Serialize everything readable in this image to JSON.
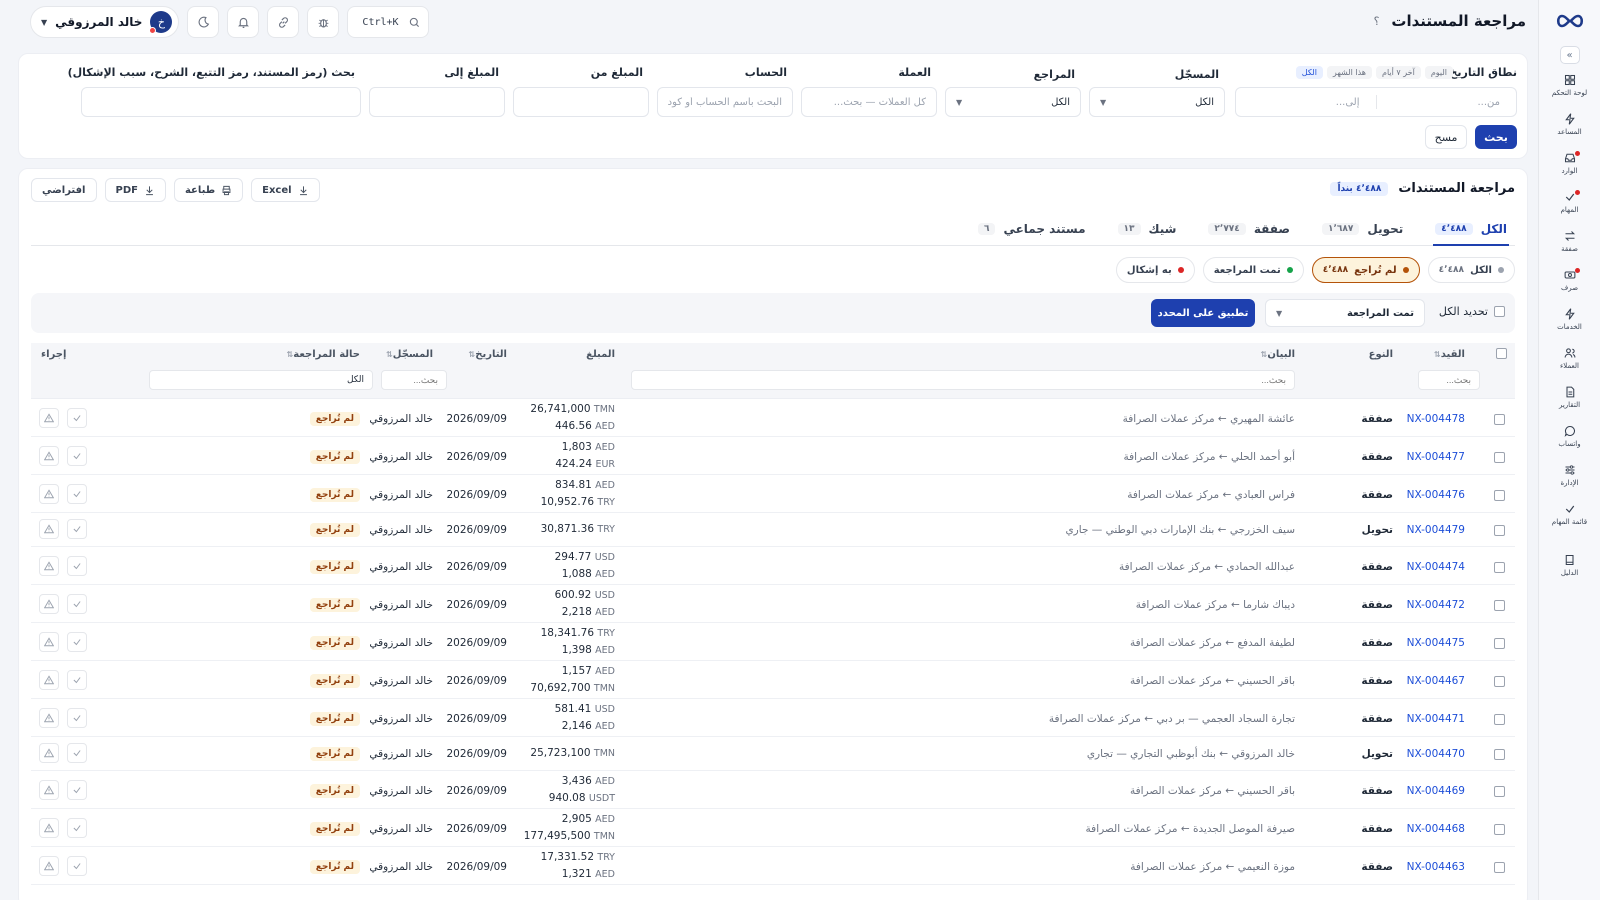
{
  "app": {
    "page_title": "مراجعة المستندات",
    "help_label": "؟",
    "user": {
      "name": "خالد المرزوقي",
      "initial": "خ"
    },
    "shortcut_label": "Ctrl+K"
  },
  "sidebar": {
    "items": [
      {
        "label": "لوحة التحكم",
        "icon": "grid-icon",
        "alert": false
      },
      {
        "label": "المساعد",
        "icon": "bolt-icon",
        "alert": false
      },
      {
        "label": "الوارد",
        "icon": "inbox-icon",
        "alert": true
      },
      {
        "label": "المهام",
        "icon": "check-icon",
        "alert": true
      },
      {
        "label": "صفقة",
        "icon": "swap-icon",
        "alert": false
      },
      {
        "label": "صرف",
        "icon": "cash-icon",
        "alert": true
      },
      {
        "label": "الخدمات",
        "icon": "bolt-icon",
        "alert": false
      },
      {
        "label": "العملاء",
        "icon": "users-icon",
        "alert": false
      },
      {
        "label": "التقارير",
        "icon": "report-icon",
        "alert": false
      },
      {
        "label": "واتساب",
        "icon": "chat-icon",
        "alert": false
      },
      {
        "label": "الإدارة",
        "icon": "sliders-icon",
        "alert": false
      },
      {
        "label": "قائمة المهام",
        "icon": "check-icon",
        "alert": false
      },
      {
        "label": "الدليل",
        "icon": "book-icon",
        "alert": false
      }
    ]
  },
  "filters": {
    "date_range_label": "نطاق التاريخ",
    "date_chips": [
      "اليوم",
      "آخر ٧ أيام",
      "هذا الشهر",
      "الكل"
    ],
    "date_from_placeholder": "من...",
    "date_to_placeholder": "إلى...",
    "registrar_label": "المسجّل",
    "registrar_value": "الكل",
    "reviewer_label": "المراجع",
    "reviewer_value": "الكل",
    "currency_label": "العملة",
    "currency_placeholder": "كل العملات — بحث...",
    "account_label": "الحساب",
    "account_placeholder": "البحث باسم الحساب أو كوده",
    "amount_from_label": "المبلغ من",
    "amount_to_label": "المبلغ إلى",
    "search_label": "بحث (رمز المستند، رمز التتبع، الشرح، سبب الإشكال)",
    "search_button": "بحث",
    "clear_button": "مسح"
  },
  "main": {
    "title": "مراجعة المستندات",
    "count_badge": "٤٬٤٨٨ بنداً",
    "exports": {
      "excel": "Excel",
      "print": "طباعة",
      "pdf": "PDF",
      "default": "افتراضي"
    },
    "tabs": [
      {
        "label": "الكل",
        "count": "٤٬٤٨٨",
        "active": true
      },
      {
        "label": "تحويل",
        "count": "١٬٦٨٧",
        "active": false
      },
      {
        "label": "صفقة",
        "count": "٢٬٧٧٤",
        "active": false
      },
      {
        "label": "شيك",
        "count": "١٣",
        "active": false
      },
      {
        "label": "مستند جماعي",
        "count": "٦",
        "active": false
      }
    ],
    "status_pills": [
      {
        "label": "الكل",
        "count": "٤٬٤٨٨",
        "color": "#9ca3af",
        "active": false
      },
      {
        "label": "لم تُراجع",
        "count": "٤٬٤٨٨",
        "color": "#b45309",
        "active": true
      },
      {
        "label": "تمت المراجعة",
        "count": "",
        "color": "#16a34a",
        "active": false
      },
      {
        "label": "به إشكال",
        "count": "",
        "color": "#dc2626",
        "active": false
      }
    ],
    "bulk": {
      "select_all": "تحديد الكل",
      "action_value": "تمت المراجعة",
      "apply": "تطبيق على المحدد"
    }
  },
  "table": {
    "headers": {
      "id": "القيد",
      "type": "النوع",
      "desc": "البيان",
      "amount": "المبلغ",
      "date": "التاريخ",
      "registrar": "المسجّل",
      "status": "حالة المراجعة",
      "action": "إجراء"
    },
    "filter_placeholder": "بحث...",
    "status_filter_value": "الكل",
    "rows": [
      {
        "id": "NX-004478",
        "type": "صفقة",
        "desc": "عائشة المهيري ← مركز عملات الصرافة",
        "amounts": [
          [
            "26,741,000",
            "TMN"
          ],
          [
            "446.56",
            "AED"
          ]
        ],
        "date": "2026/09/09",
        "registrar": "خالد المرزوقي",
        "status": "لم تُراجع"
      },
      {
        "id": "NX-004477",
        "type": "صفقة",
        "desc": "أبو أحمد الحلي ← مركز عملات الصرافة",
        "amounts": [
          [
            "1,803",
            "AED"
          ],
          [
            "424.24",
            "EUR"
          ]
        ],
        "date": "2026/09/09",
        "registrar": "خالد المرزوقي",
        "status": "لم تُراجع"
      },
      {
        "id": "NX-004476",
        "type": "صفقة",
        "desc": "فراس العبادي ← مركز عملات الصرافة",
        "amounts": [
          [
            "834.81",
            "AED"
          ],
          [
            "10,952.76",
            "TRY"
          ]
        ],
        "date": "2026/09/09",
        "registrar": "خالد المرزوقي",
        "status": "لم تُراجع"
      },
      {
        "id": "NX-004479",
        "type": "تحويل",
        "desc": "سيف الخزرجي ← بنك الإمارات دبي الوطني — جاري",
        "amounts": [
          [
            "30,871.36",
            "TRY"
          ]
        ],
        "date": "2026/09/09",
        "registrar": "خالد المرزوقي",
        "status": "لم تُراجع"
      },
      {
        "id": "NX-004474",
        "type": "صفقة",
        "desc": "عبدالله الحمادي ← مركز عملات الصرافة",
        "amounts": [
          [
            "294.77",
            "USD"
          ],
          [
            "1,088",
            "AED"
          ]
        ],
        "date": "2026/09/09",
        "registrar": "خالد المرزوقي",
        "status": "لم تُراجع"
      },
      {
        "id": "NX-004472",
        "type": "صفقة",
        "desc": "ديباك شارما ← مركز عملات الصرافة",
        "amounts": [
          [
            "600.92",
            "USD"
          ],
          [
            "2,218",
            "AED"
          ]
        ],
        "date": "2026/09/09",
        "registrar": "خالد المرزوقي",
        "status": "لم تُراجع"
      },
      {
        "id": "NX-004475",
        "type": "صفقة",
        "desc": "لطيفة المدفع ← مركز عملات الصرافة",
        "amounts": [
          [
            "18,341.76",
            "TRY"
          ],
          [
            "1,398",
            "AED"
          ]
        ],
        "date": "2026/09/09",
        "registrar": "خالد المرزوقي",
        "status": "لم تُراجع"
      },
      {
        "id": "NX-004467",
        "type": "صفقة",
        "desc": "باقر الحسيني ← مركز عملات الصرافة",
        "amounts": [
          [
            "1,157",
            "AED"
          ],
          [
            "70,692,700",
            "TMN"
          ]
        ],
        "date": "2026/09/09",
        "registrar": "خالد المرزوقي",
        "status": "لم تُراجع"
      },
      {
        "id": "NX-004471",
        "type": "صفقة",
        "desc": "تجارة السجاد العجمي — بر دبي ← مركز عملات الصرافة",
        "amounts": [
          [
            "581.41",
            "USD"
          ],
          [
            "2,146",
            "AED"
          ]
        ],
        "date": "2026/09/09",
        "registrar": "خالد المرزوقي",
        "status": "لم تُراجع"
      },
      {
        "id": "NX-004470",
        "type": "تحويل",
        "desc": "خالد المرزوقي ← بنك أبوظبي التجاري — تجاري",
        "amounts": [
          [
            "25,723,100",
            "TMN"
          ]
        ],
        "date": "2026/09/09",
        "registrar": "خالد المرزوقي",
        "status": "لم تُراجع"
      },
      {
        "id": "NX-004469",
        "type": "صفقة",
        "desc": "باقر الحسيني ← مركز عملات الصرافة",
        "amounts": [
          [
            "3,436",
            "AED"
          ],
          [
            "940.08",
            "USDT"
          ]
        ],
        "date": "2026/09/09",
        "registrar": "خالد المرزوقي",
        "status": "لم تُراجع"
      },
      {
        "id": "NX-004468",
        "type": "صفقة",
        "desc": "صيرفة الموصل الجديدة ← مركز عملات الصرافة",
        "amounts": [
          [
            "2,905",
            "AED"
          ],
          [
            "177,495,500",
            "TMN"
          ]
        ],
        "date": "2026/09/09",
        "registrar": "خالد المرزوقي",
        "status": "لم تُراجع"
      },
      {
        "id": "NX-004463",
        "type": "صفقة",
        "desc": "موزة النعيمي ← مركز عملات الصرافة",
        "amounts": [
          [
            "17,331.52",
            "TRY"
          ],
          [
            "1,321",
            "AED"
          ]
        ],
        "date": "2026/09/09",
        "registrar": "خالد المرزوقي",
        "status": "لم تُراجع"
      }
    ]
  }
}
